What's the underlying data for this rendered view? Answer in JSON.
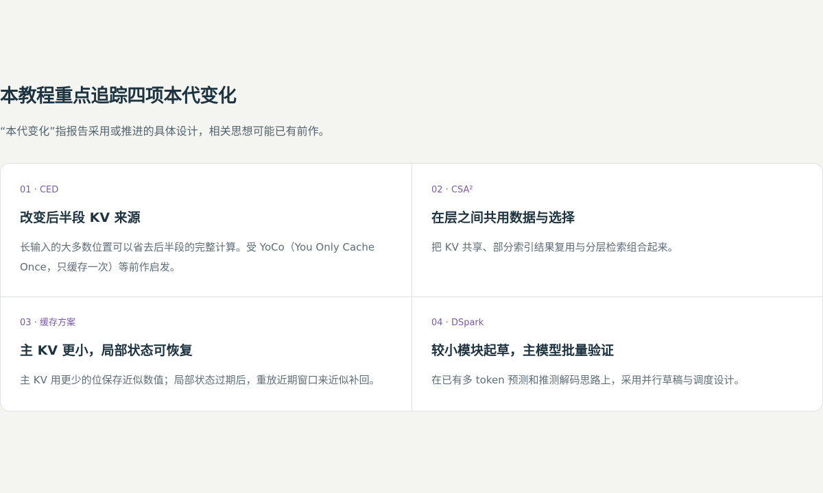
{
  "section": {
    "title": "本教程重点追踪四项本代变化",
    "subtitle": "“本代变化”指报告采用或推进的具体设计，相关思想可能已有前作。"
  },
  "cards": [
    {
      "tag": "01 · CED",
      "title": "改变后半段 KV 来源",
      "desc": "长输入的大多数位置可以省去后半段的完整计算。受 YoCo（You Only Cache Once，只缓存一次）等前作启发。"
    },
    {
      "tag": "02 · CSA²",
      "title": "在层之间共用数据与选择",
      "desc": "把 KV 共享、部分索引结果复用与分层检索组合起来。"
    },
    {
      "tag": "03 · 缓存方案",
      "title": "主 KV 更小，局部状态可恢复",
      "desc": "主 KV 用更少的位保存近似数值；局部状态过期后，重放近期窗口来近似补回。"
    },
    {
      "tag": "04 · DSpark",
      "title": "较小模块起草，主模型批量验证",
      "desc": "在已有多 token 预测和推测解码思路上，采用并行草稿与调度设计。"
    }
  ]
}
